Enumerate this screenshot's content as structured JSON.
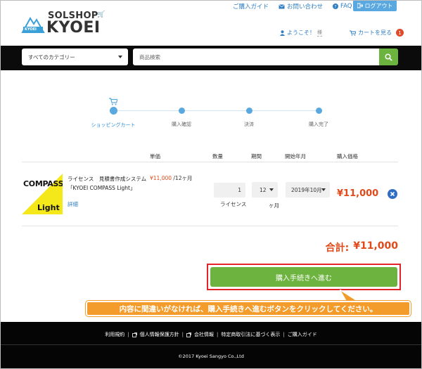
{
  "header": {
    "logo_top": "SOLSHOP",
    "logo_main": "KYOEI",
    "logo_badge": "KYOEI",
    "top_links": [
      {
        "label": "ご購入ガイド",
        "icon": "none"
      },
      {
        "label": "お問い合わせ",
        "icon": "mail-icon"
      },
      {
        "label": "FAQ",
        "icon": "question-icon"
      }
    ],
    "logout_label": "ログアウト",
    "welcome_label": "ようこそ！",
    "welcome_name": "様",
    "cart_label": "カートを見る",
    "cart_count": "1"
  },
  "search": {
    "category_value": "すべてのカテゴリー",
    "placeholder": "商品検索"
  },
  "steps": [
    {
      "label": "ショッピングカート",
      "active": true
    },
    {
      "label": "購入確認",
      "active": false
    },
    {
      "label": "決済",
      "active": false
    },
    {
      "label": "購入完了",
      "active": false
    }
  ],
  "table": {
    "headers": {
      "unit_price": "単価",
      "quantity": "数量",
      "duration": "期間",
      "start": "開始年月",
      "total": "購入価格"
    },
    "items": [
      {
        "thumb_line1": "COMPASS",
        "thumb_line2": "Light",
        "name": "ライセンス　見積書作成システム「KYOEI COMPASS Light」",
        "detail": "詳細",
        "price": "¥11,000",
        "price_unit": "/12ヶ月",
        "quantity": "1",
        "quantity_unit": "ライセンス",
        "duration": "12",
        "duration_unit": "ヶ月",
        "start": "2019年10月",
        "total": "¥11,000"
      }
    ]
  },
  "grand_total": {
    "label": "合計:",
    "value": "¥11,000"
  },
  "cta_label": "購入手続きへ進む",
  "callout_text": "内容に間違いがなければ、購入手続きへ進むボタンをクリックしてください。",
  "footer": {
    "links": [
      "利用規約",
      "個人情報保護方針",
      "会社情報",
      "特定商取引法に基づく表示",
      "ご購入ガイド"
    ],
    "separator": "|",
    "copyright": "©2017 Kyoei Sangyo Co.,Ltd"
  },
  "colors": {
    "accent_blue": "#5aa8e0",
    "link_blue": "#2f7ec2",
    "green": "#6db33f",
    "price_red": "#e04a1a",
    "callout_orange": "#f39c2b"
  }
}
